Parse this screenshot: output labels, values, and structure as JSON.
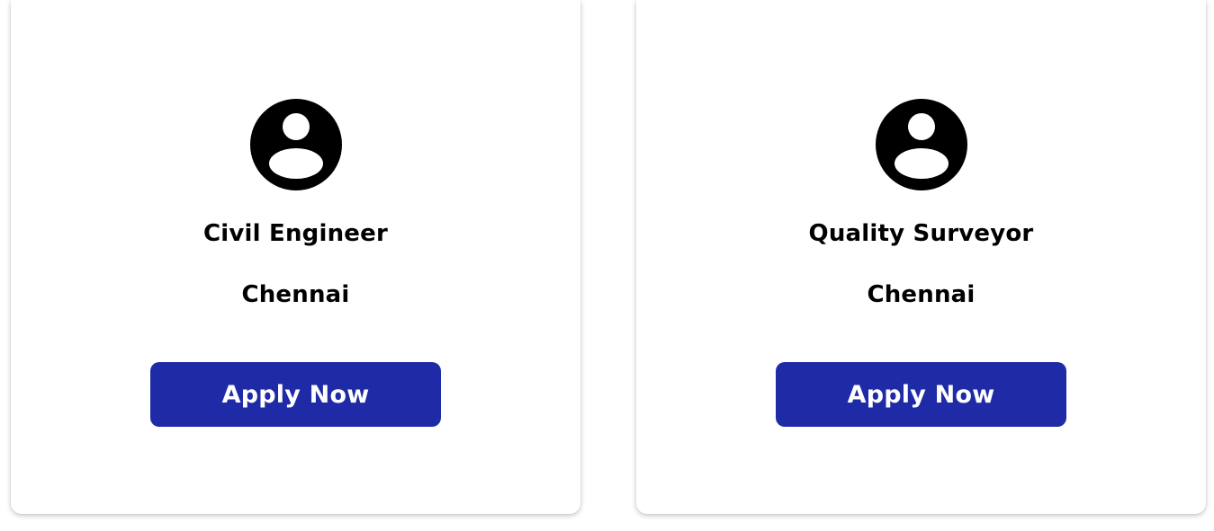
{
  "cards": [
    {
      "icon": "account-circle-icon",
      "title": "Civil Engineer",
      "location": "Chennai",
      "button_label": "Apply Now"
    },
    {
      "icon": "account-circle-icon",
      "title": "Quality Surveyor",
      "location": "Chennai",
      "button_label": "Apply Now"
    }
  ],
  "colors": {
    "button_bg": "#1f2ba6",
    "button_text": "#ffffff",
    "text": "#000000",
    "card_bg": "#ffffff"
  }
}
